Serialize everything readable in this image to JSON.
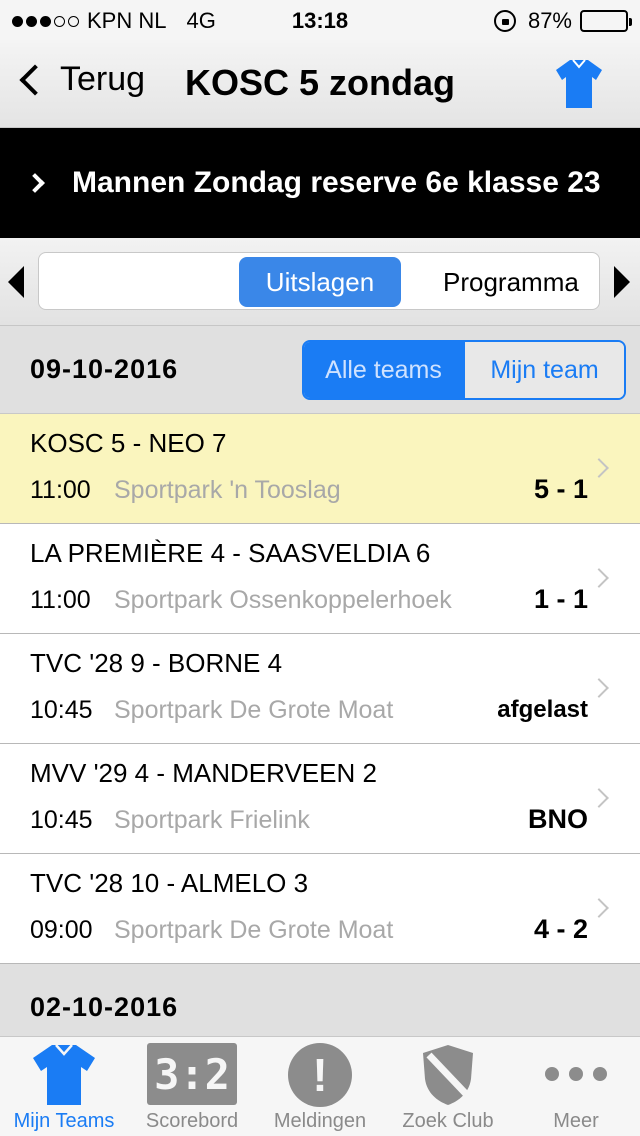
{
  "status_bar": {
    "carrier": "KPN NL",
    "network": "4G",
    "time": "13:18",
    "battery": "87%",
    "battery_level": 0.87
  },
  "nav": {
    "back_label": "Terug",
    "title": "KOSC 5 zondag",
    "shirt_icon": "shirt-icon",
    "accent": "#1a7cf4"
  },
  "competition": {
    "label": "Mannen Zondag reserve 6e klasse 23"
  },
  "pager": {
    "active": "Uitslagen",
    "next": "Programma"
  },
  "filter": {
    "all": "Alle teams",
    "mine": "Mijn team",
    "selected": "all"
  },
  "sections": [
    {
      "date": "09-10-2016",
      "matches": [
        {
          "title": "KOSC 5  - NEO 7",
          "time": "11:00",
          "venue": "Sportpark 'n Tooslag",
          "score": "5 - 1",
          "highlight": true
        },
        {
          "title": "LA PREMIÈRE 4  - SAASVELDIA 6",
          "time": "11:00",
          "venue": "Sportpark Ossenkoppelerhoek",
          "score": "1 - 1",
          "highlight": false
        },
        {
          "title": "TVC '28 9  - BORNE 4",
          "time": "10:45",
          "venue": "Sportpark De Grote Moat",
          "score": "afgelast",
          "highlight": false
        },
        {
          "title": "MVV '29 4  - MANDERVEEN 2",
          "time": "10:45",
          "venue": "Sportpark Frielink",
          "score": "BNO",
          "highlight": false
        },
        {
          "title": "TVC '28 10  - ALMELO 3",
          "time": "09:00",
          "venue": "Sportpark De Grote Moat",
          "score": "4 - 2",
          "highlight": false
        }
      ]
    },
    {
      "date": "02-10-2016",
      "matches": []
    }
  ],
  "tabbar": {
    "tabs": [
      {
        "label": "Mijn Teams",
        "icon": "shirt-icon",
        "active": true
      },
      {
        "label": "Scorebord",
        "icon": "scoreboard-icon",
        "active": false
      },
      {
        "label": "Meldingen",
        "icon": "alert-icon",
        "active": false
      },
      {
        "label": "Zoek Club",
        "icon": "shield-icon",
        "active": false
      },
      {
        "label": "Meer",
        "icon": "more-icon",
        "active": false
      }
    ],
    "scoreboard_glyph": "3:2",
    "alert_glyph": "!"
  }
}
